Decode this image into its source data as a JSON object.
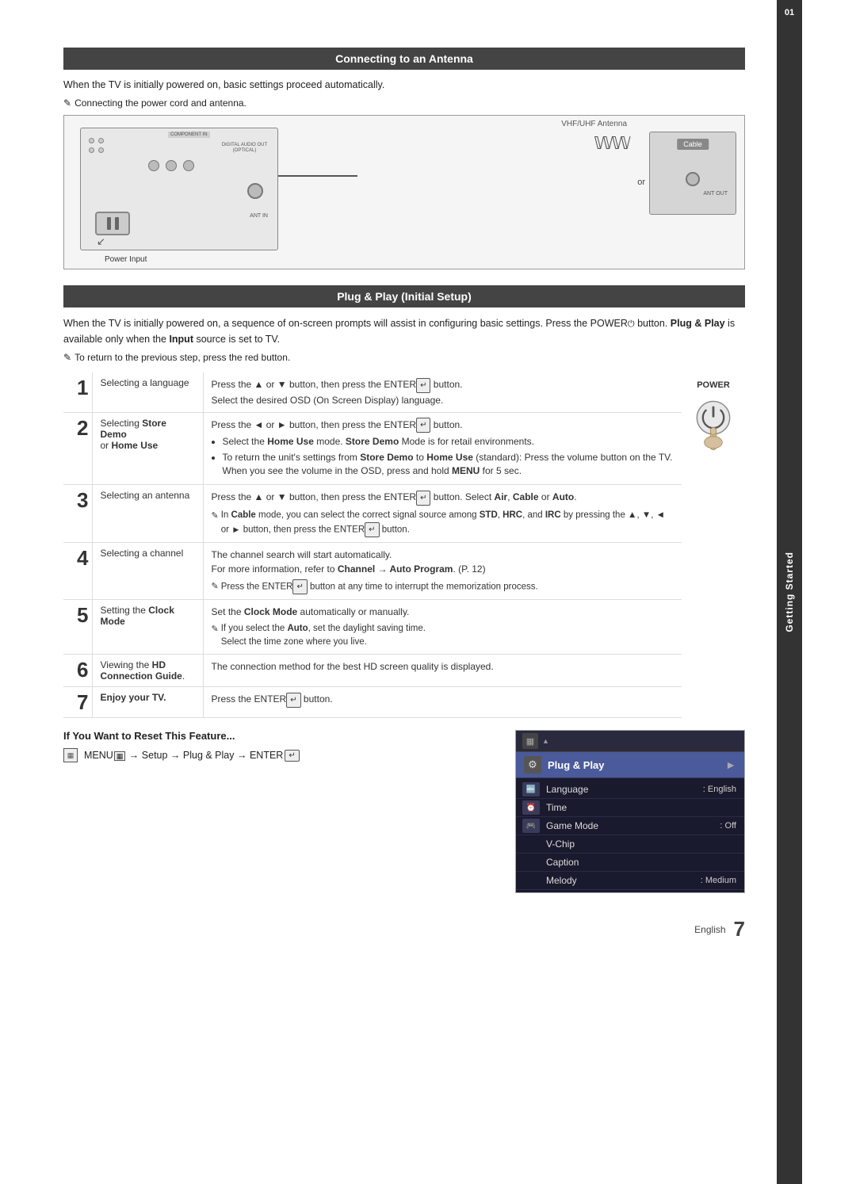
{
  "page": {
    "title": "Getting Started",
    "chapter_number": "01",
    "page_number": "7",
    "language_label": "English"
  },
  "connecting_section": {
    "header": "Connecting to an Antenna",
    "intro": "When the TV is initially powered on, basic settings proceed automatically.",
    "note": "Connecting the power cord and antenna.",
    "diagram": {
      "power_input_label": "Power Input",
      "vhf_label": "VHF/UHF Antenna",
      "cable_label": "Cable",
      "or_text": "or",
      "ant_in_label": "ANT IN",
      "ant_out_label": "ANT OUT",
      "component_in": "COMPONENT IN",
      "digital_audio": "DIGITAL AUDIO OUT (OPTICAL)"
    }
  },
  "plug_play_section": {
    "header": "Plug & Play (Initial Setup)",
    "intro": "When the TV is initially powered on, a sequence of on-screen prompts will assist in configuring basic settings. Press the POWER button. Plug & Play is available only when the Input source is set to TV.",
    "note": "To return to the previous step, press the red button.",
    "power_label": "POWER",
    "steps": [
      {
        "number": "1",
        "title": "Selecting a language",
        "description": "Press the ▲ or ▼ button, then press the ENTER button.\nSelect the desired OSD (On Screen Display) language."
      },
      {
        "number": "2",
        "title": "Selecting Store Demo or Home Use",
        "description_main": "Press the ◄ or ► button, then press the ENTER button.",
        "bullets": [
          "Select the Home Use mode. Store Demo Mode is for retail environments.",
          "To return the unit's settings from Store Demo to Home Use (standard): Press the volume button on the TV. When you see the volume in the OSD, press and hold MENU for 5 sec."
        ]
      },
      {
        "number": "3",
        "title": "Selecting an antenna",
        "description": "Press the ▲ or ▼ button, then press the ENTER button. Select Air, Cable or Auto.",
        "note": "In Cable mode, you can select the correct signal source among STD, HRC, and IRC by pressing the ▲, ▼, ◄ or ► button, then press the ENTER button."
      },
      {
        "number": "4",
        "title": "Selecting a channel",
        "description": "The channel search will start automatically.\nFor more information, refer to Channel → Auto Program. (P. 12)",
        "note": "Press the ENTER button at any time to interrupt the memorization process."
      },
      {
        "number": "5",
        "title": "Setting the Clock Mode",
        "description": "Set the Clock Mode automatically or manually.",
        "note": "If you select the Auto, set the daylight saving time.\nSelect the time zone where you live."
      },
      {
        "number": "6",
        "title": "Viewing the HD Connection Guide.",
        "description": "The connection method for the best HD screen quality is displayed."
      },
      {
        "number": "7",
        "title": "Enjoy your TV.",
        "description": "Press the ENTER button."
      }
    ]
  },
  "reset_section": {
    "title": "If You Want to Reset This Feature...",
    "instruction": "MENU → Setup → Plug & Play → ENTER"
  },
  "setup_menu": {
    "header_icon": "⚙",
    "header_label": "Plug & Play",
    "items": [
      {
        "icon": "🔤",
        "name": "Language",
        "value": ": English",
        "highlighted": false
      },
      {
        "icon": "⏰",
        "name": "Time",
        "value": "",
        "highlighted": false
      },
      {
        "icon": "🎮",
        "name": "Game Mode",
        "value": ": Off",
        "highlighted": false
      },
      {
        "icon": "",
        "name": "V-Chip",
        "value": "",
        "highlighted": false
      },
      {
        "icon": "",
        "name": "Caption",
        "value": "",
        "highlighted": false
      },
      {
        "icon": "",
        "name": "Melody",
        "value": ": Medium",
        "highlighted": false
      }
    ]
  }
}
